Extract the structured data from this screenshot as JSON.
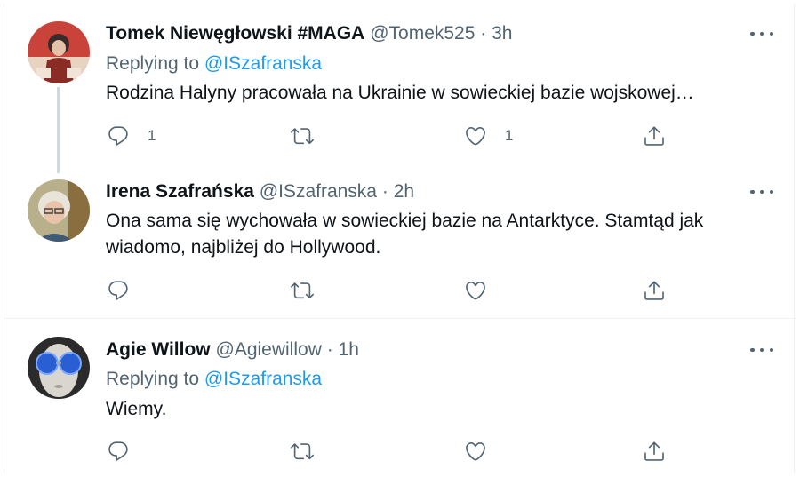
{
  "tweets": [
    {
      "name": "Tomek Niewęgłowski #MAGA",
      "handle": "@Tomek525",
      "separator": "·",
      "time": "3h",
      "replying_prefix": "Replying to",
      "replying_to": "@ISzafranska",
      "text": "Rodzina Halyny pracowała na Ukrainie w sowieckiej bazie wojskowej…",
      "reply_count": "1",
      "retweet_count": "",
      "like_count": "1"
    },
    {
      "name": "Irena Szafrańska",
      "handle": "@ISzafranska",
      "separator": "·",
      "time": "2h",
      "text": "Ona sama się wychowała w sowieckiej bazie na Antarktyce. Stamtąd jak wiadomo, najbliżej do Hollywood.",
      "reply_count": "",
      "retweet_count": "",
      "like_count": ""
    },
    {
      "name": "Agie Willow",
      "handle": "@Agiewillow",
      "separator": "·",
      "time": "1h",
      "replying_prefix": "Replying to",
      "replying_to": "@ISzafranska",
      "text": "Wiemy.",
      "reply_count": "",
      "retweet_count": "",
      "like_count": ""
    }
  ],
  "icons": {
    "reply": "reply-icon",
    "retweet": "retweet-icon",
    "like": "heart-icon",
    "share": "share-icon",
    "more": "more-icon"
  },
  "colors": {
    "link": "#1d9bf0",
    "secondary_text": "#536471",
    "primary_text": "#0f1419",
    "thread_line": "#cfd9de"
  }
}
